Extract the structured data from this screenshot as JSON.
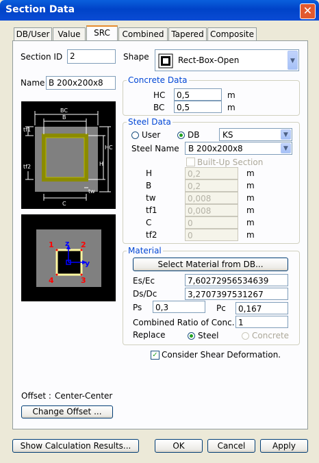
{
  "window": {
    "title": "Section Data",
    "close_symbol": "✕"
  },
  "tabs": [
    "DB/User",
    "Value",
    "SRC",
    "Combined",
    "Tapered",
    "Composite"
  ],
  "left": {
    "section_id_label": "Section ID",
    "section_id_value": "2",
    "name_label": "Name",
    "name_value": "B 200x200x8",
    "diagram": {
      "bc": "BC",
      "b": "B",
      "hc": "HC",
      "h": "H",
      "c": "C",
      "tw": "tw",
      "tf1": "tf1",
      "tf2": "tf2"
    },
    "preview": {
      "z": "z",
      "y": "y",
      "n1": "1",
      "n2": "2",
      "n3": "3",
      "n4": "4"
    },
    "offset_label": "Offset :",
    "offset_value": "Center-Center",
    "change_offset_label": "Change Offset ..."
  },
  "shape": {
    "label": "Shape",
    "value": "Rect-Box-Open"
  },
  "concrete": {
    "title": "Concrete Data",
    "hc_label": "HC",
    "hc_value": "0,5",
    "bc_label": "BC",
    "bc_value": "0,5",
    "unit": "m"
  },
  "steel": {
    "title": "Steel Data",
    "user_label": "User",
    "db_label": "DB",
    "db_value": "KS",
    "steel_name_label": "Steel Name",
    "steel_name_value": "B 200x200x8",
    "builtup_label": "Built-Up Section",
    "unit": "m",
    "rows": [
      {
        "label": "H",
        "value": "0,2"
      },
      {
        "label": "B",
        "value": "0,2"
      },
      {
        "label": "tw",
        "value": "0,008"
      },
      {
        "label": "tf1",
        "value": "0,008"
      },
      {
        "label": "C",
        "value": "0"
      },
      {
        "label": "tf2",
        "value": "0"
      }
    ]
  },
  "material": {
    "title": "Material",
    "select_btn": "Select Material from DB...",
    "es_ec_label": "Es/Ec",
    "es_ec_value": "7,60272956534639",
    "ds_dc_label": "Ds/Dc",
    "ds_dc_value": "3,2707397531267",
    "ps_label": "Ps",
    "ps_value": "0,3",
    "pc_label": "Pc",
    "pc_value": "0,167",
    "ratio_label": "Combined Ratio of Conc.",
    "ratio_value": "1",
    "replace_label": "Replace",
    "steel_option": "Steel",
    "concrete_option": "Concrete"
  },
  "shear": {
    "label": "Consider Shear Deformation.",
    "check": "✓"
  },
  "footer": {
    "show_calc": "Show Calculation Results...",
    "ok": "OK",
    "cancel": "Cancel",
    "apply": "Apply"
  }
}
